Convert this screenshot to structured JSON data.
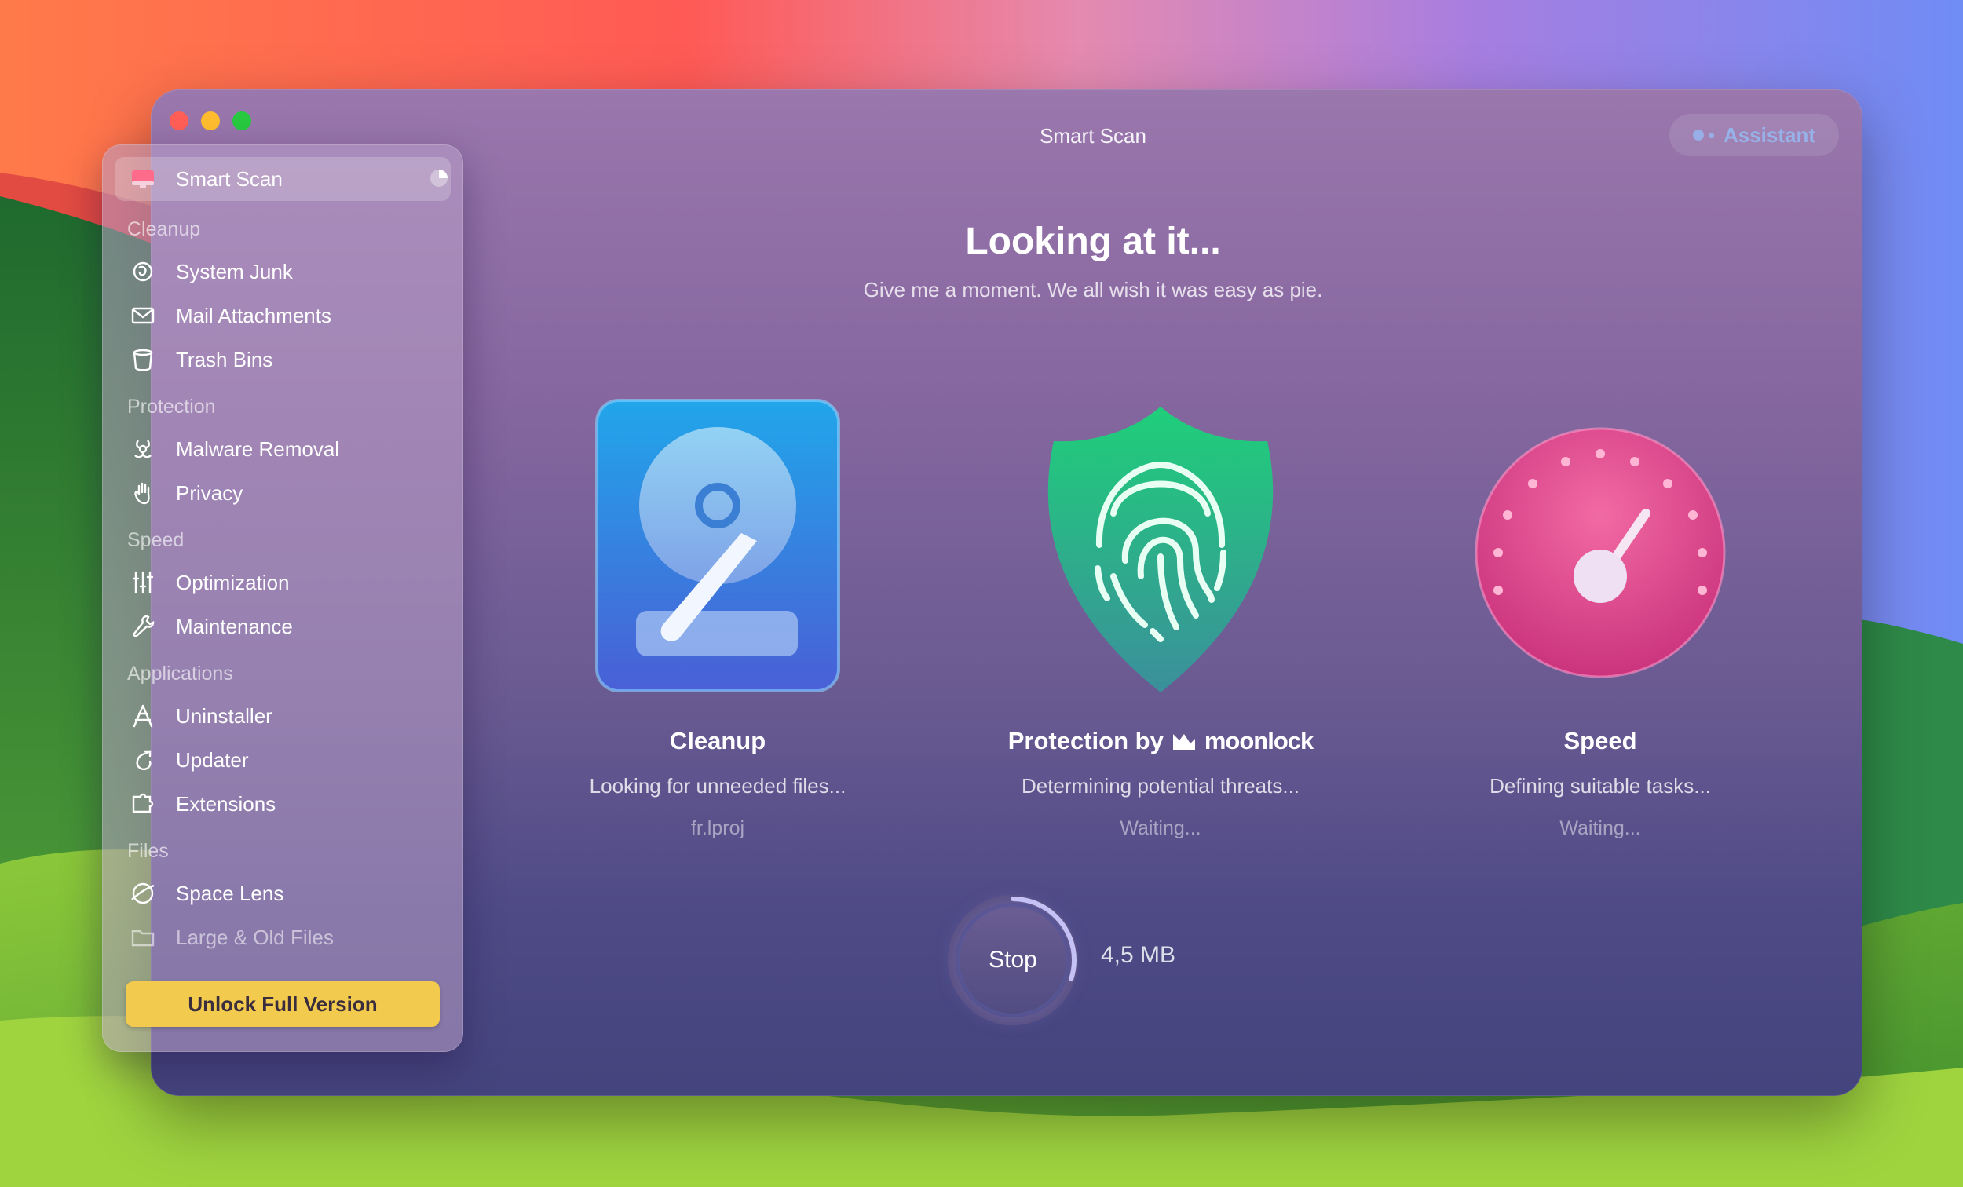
{
  "window": {
    "title": "Smart Scan",
    "assistant_label": "Assistant"
  },
  "sidebar": {
    "selected": {
      "label": "Smart Scan"
    },
    "sections": [
      {
        "label": "Cleanup",
        "items": [
          {
            "label": "System Junk",
            "icon": "broom-icon"
          },
          {
            "label": "Mail Attachments",
            "icon": "envelope-icon"
          },
          {
            "label": "Trash Bins",
            "icon": "trash-icon"
          }
        ]
      },
      {
        "label": "Protection",
        "items": [
          {
            "label": "Malware Removal",
            "icon": "biohazard-icon"
          },
          {
            "label": "Privacy",
            "icon": "hand-icon"
          }
        ]
      },
      {
        "label": "Speed",
        "items": [
          {
            "label": "Optimization",
            "icon": "sliders-icon"
          },
          {
            "label": "Maintenance",
            "icon": "wrench-icon"
          }
        ]
      },
      {
        "label": "Applications",
        "items": [
          {
            "label": "Uninstaller",
            "icon": "apps-icon"
          },
          {
            "label": "Updater",
            "icon": "update-arrow-icon"
          },
          {
            "label": "Extensions",
            "icon": "puzzle-icon"
          }
        ]
      },
      {
        "label": "Files",
        "items": [
          {
            "label": "Space Lens",
            "icon": "planet-icon"
          },
          {
            "label": "Large & Old Files",
            "icon": "folder-icon"
          }
        ]
      }
    ],
    "unlock_label": "Unlock Full Version"
  },
  "main": {
    "heading": "Looking at it...",
    "subheading": "Give me a moment. We all wish it was easy as pie.",
    "modules": [
      {
        "title": "Cleanup",
        "status": "Looking for unneeded files...",
        "detail": "fr.lproj"
      },
      {
        "title": "Protection by",
        "brand": "moonlock",
        "status": "Determining potential threats...",
        "detail": "Waiting..."
      },
      {
        "title": "Speed",
        "status": "Defining suitable tasks...",
        "detail": "Waiting..."
      }
    ],
    "stop_label": "Stop",
    "scan_size": "4,5 MB",
    "scan_progress": 0.3
  },
  "colors": {
    "accent_yellow": "#f1ca4e",
    "cleanup_blue": "#2f8fe0",
    "protection_green": "#1fc58a",
    "speed_pink": "#e24a8a"
  }
}
